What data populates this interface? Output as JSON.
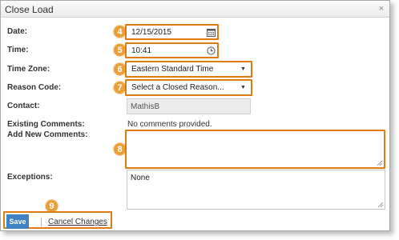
{
  "dialog": {
    "title": "Close Load",
    "close_glyph": "×"
  },
  "form": {
    "date": {
      "label": "Date:",
      "value": "12/15/2015",
      "badge": "4",
      "icon": "calendar-icon"
    },
    "time": {
      "label": "Time:",
      "value": "10:41",
      "badge": "5",
      "icon": "clock-icon"
    },
    "time_zone": {
      "label": "Time Zone:",
      "value": "Eastern Standard Time",
      "badge": "6",
      "arrow": "▼"
    },
    "reason_code": {
      "label": "Reason Code:",
      "value": "Select a Closed Reason...",
      "badge": "7",
      "arrow": "▼"
    },
    "contact": {
      "label": "Contact:",
      "value": "MathisB"
    },
    "existing_comments": {
      "label": "Existing Comments:",
      "value": "No comments provided."
    },
    "new_comments": {
      "label": "Add New Comments:",
      "value": "",
      "badge": "8"
    },
    "exceptions": {
      "label": "Exceptions:",
      "value": "None"
    }
  },
  "footer": {
    "save_label": "Save",
    "cancel_label": "Cancel Changes",
    "badge": "9"
  },
  "colors": {
    "highlight": "#e07b10",
    "badge": "#e9a03b",
    "save_button": "#3f82c4"
  }
}
